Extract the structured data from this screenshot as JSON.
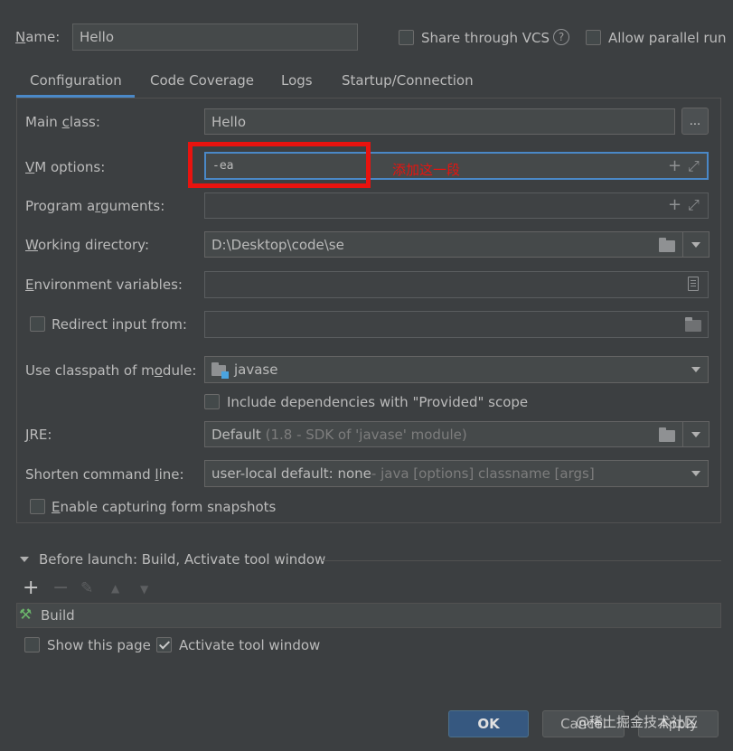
{
  "header": {
    "name_label": "Name:",
    "name_value": "Hello",
    "share_vcs_label": "Share through VCS",
    "help_glyph": "?",
    "allow_parallel_label": "Allow parallel run"
  },
  "tabs": [
    {
      "label": "Configuration",
      "active": true
    },
    {
      "label": "Code Coverage"
    },
    {
      "label": "Logs"
    },
    {
      "label": "Startup/Connection"
    }
  ],
  "config": {
    "main_class_label": "Main class:",
    "main_class_value": "Hello",
    "browse_label": "...",
    "vm_options_label": "VM options:",
    "vm_options_value": "-ea",
    "annotation_text": "添加这一段",
    "program_args_label": "Program arguments:",
    "program_args_value": "",
    "working_dir_label": "Working directory:",
    "working_dir_value": "D:\\Desktop\\code\\se",
    "env_vars_label": "Environment variables:",
    "env_vars_value": "",
    "redirect_label": "Redirect input from:",
    "redirect_value": "",
    "classpath_label": "Use classpath of module:",
    "classpath_value": "javase",
    "include_deps_label": "Include dependencies with \"Provided\" scope",
    "jre_label": "JRE:",
    "jre_value": "Default",
    "jre_hint": "(1.8 - SDK of 'javase' module)",
    "shorten_label": "Shorten command line:",
    "shorten_value": "user-local default: none",
    "shorten_hint": " - java [options] classname [args]",
    "capture_label": "Enable capturing form snapshots"
  },
  "before_launch": {
    "title": "Before launch: Build, Activate tool window",
    "toolbar": [
      "+",
      "−",
      "✎",
      "▲",
      "▼"
    ],
    "items": [
      "Build"
    ]
  },
  "options": {
    "show_page_label": "Show this page",
    "activate_label": "Activate tool window"
  },
  "buttons": {
    "ok": "OK",
    "cancel": "Cancel",
    "apply": "Apply"
  },
  "watermark": "@稀土掘金技术社区",
  "colors": {
    "background": "#3c3f41",
    "panel": "#3c3f41",
    "field": "#45494a",
    "accent": "#4a88c7",
    "annotation": "#e8130f",
    "ok_button": "#365880"
  }
}
